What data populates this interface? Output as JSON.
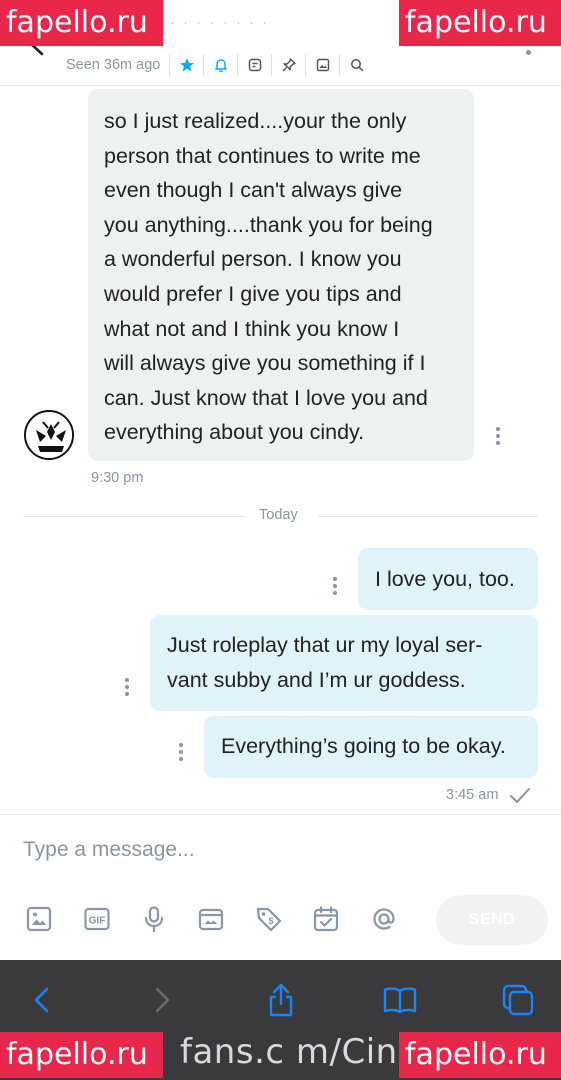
{
  "watermark": "fapello.ru",
  "header": {
    "name": "· · · · · · · ·",
    "seen": "Seen 36m ago",
    "icons": [
      "star-icon",
      "bell-icon",
      "note-icon",
      "pin-icon",
      "image-icon",
      "search-icon"
    ]
  },
  "messages": [
    {
      "direction": "incoming",
      "lines": [
        "so I just realized....your the only",
        "person that continues to write me",
        "even though I can't always give",
        "you anything....thank you for being",
        "a wonderful person. I know you",
        "would prefer I give you tips and",
        "what not and I think you know I",
        "will always give you something if I",
        "can. Just know that I love you and",
        "everything about you cindy."
      ],
      "time": "9:30 pm"
    }
  ],
  "divider_label": "Today",
  "outgoing": [
    {
      "lines": [
        "I love you, too."
      ]
    },
    {
      "lines": [
        "Just roleplay that ur my loyal ser-",
        "vant subby and I’m ur goddess."
      ]
    },
    {
      "lines": [
        "Everything’s going to be okay."
      ]
    }
  ],
  "outgoing_time": "3:45 am",
  "composer": {
    "placeholder": "Type a message...",
    "tools": [
      "image-icon",
      "gif-icon",
      "microphone-icon",
      "vault-icon",
      "price-tag-icon",
      "schedule-icon",
      "mention-icon"
    ],
    "send_label": "SEND"
  },
  "browser": {
    "url_fragment": "fans.c m/Cind",
    "buttons": [
      "back-icon",
      "forward-icon",
      "share-icon",
      "bookmarks-icon",
      "tabs-icon"
    ]
  },
  "colors": {
    "accent": "#00aff0",
    "bubble_in": "#eef1f2",
    "bubble_out": "#dff3f9",
    "muted": "#8a96a3",
    "watermark": "#e8274b",
    "browser_bar": "#3a3a3c",
    "browser_icon": "#1a84ff"
  }
}
